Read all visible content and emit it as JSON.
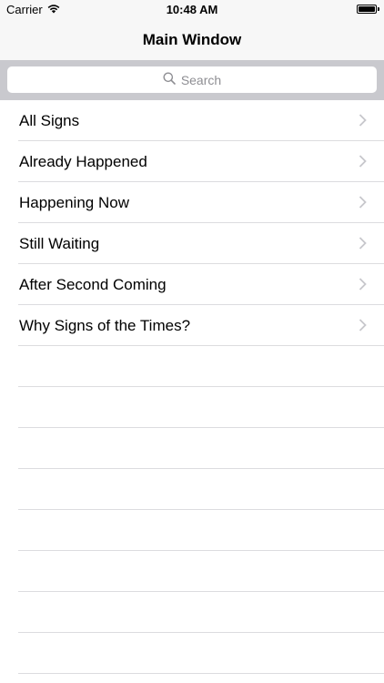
{
  "status_bar": {
    "carrier": "Carrier",
    "time": "10:48 AM",
    "battery_level": 1.0,
    "icons": [
      "wifi-icon",
      "battery-icon"
    ]
  },
  "nav_bar": {
    "title": "Main Window"
  },
  "search": {
    "placeholder": "Search",
    "icon": "search-icon"
  },
  "list": {
    "items": [
      {
        "label": "All Signs",
        "icon": "chevron-right-icon"
      },
      {
        "label": "Already Happened",
        "icon": "chevron-right-icon"
      },
      {
        "label": "Happening Now",
        "icon": "chevron-right-icon"
      },
      {
        "label": "Still Waiting",
        "icon": "chevron-right-icon"
      },
      {
        "label": "After Second Coming",
        "icon": "chevron-right-icon"
      },
      {
        "label": "Why Signs of the Times?",
        "icon": "chevron-right-icon"
      }
    ]
  },
  "colors": {
    "bar_background": "#f7f7f7",
    "search_background": "#c9c9ce",
    "separator": "#dcdcdf",
    "placeholder_gray": "#8e8e93",
    "chevron_gray": "#c7c7cc"
  }
}
